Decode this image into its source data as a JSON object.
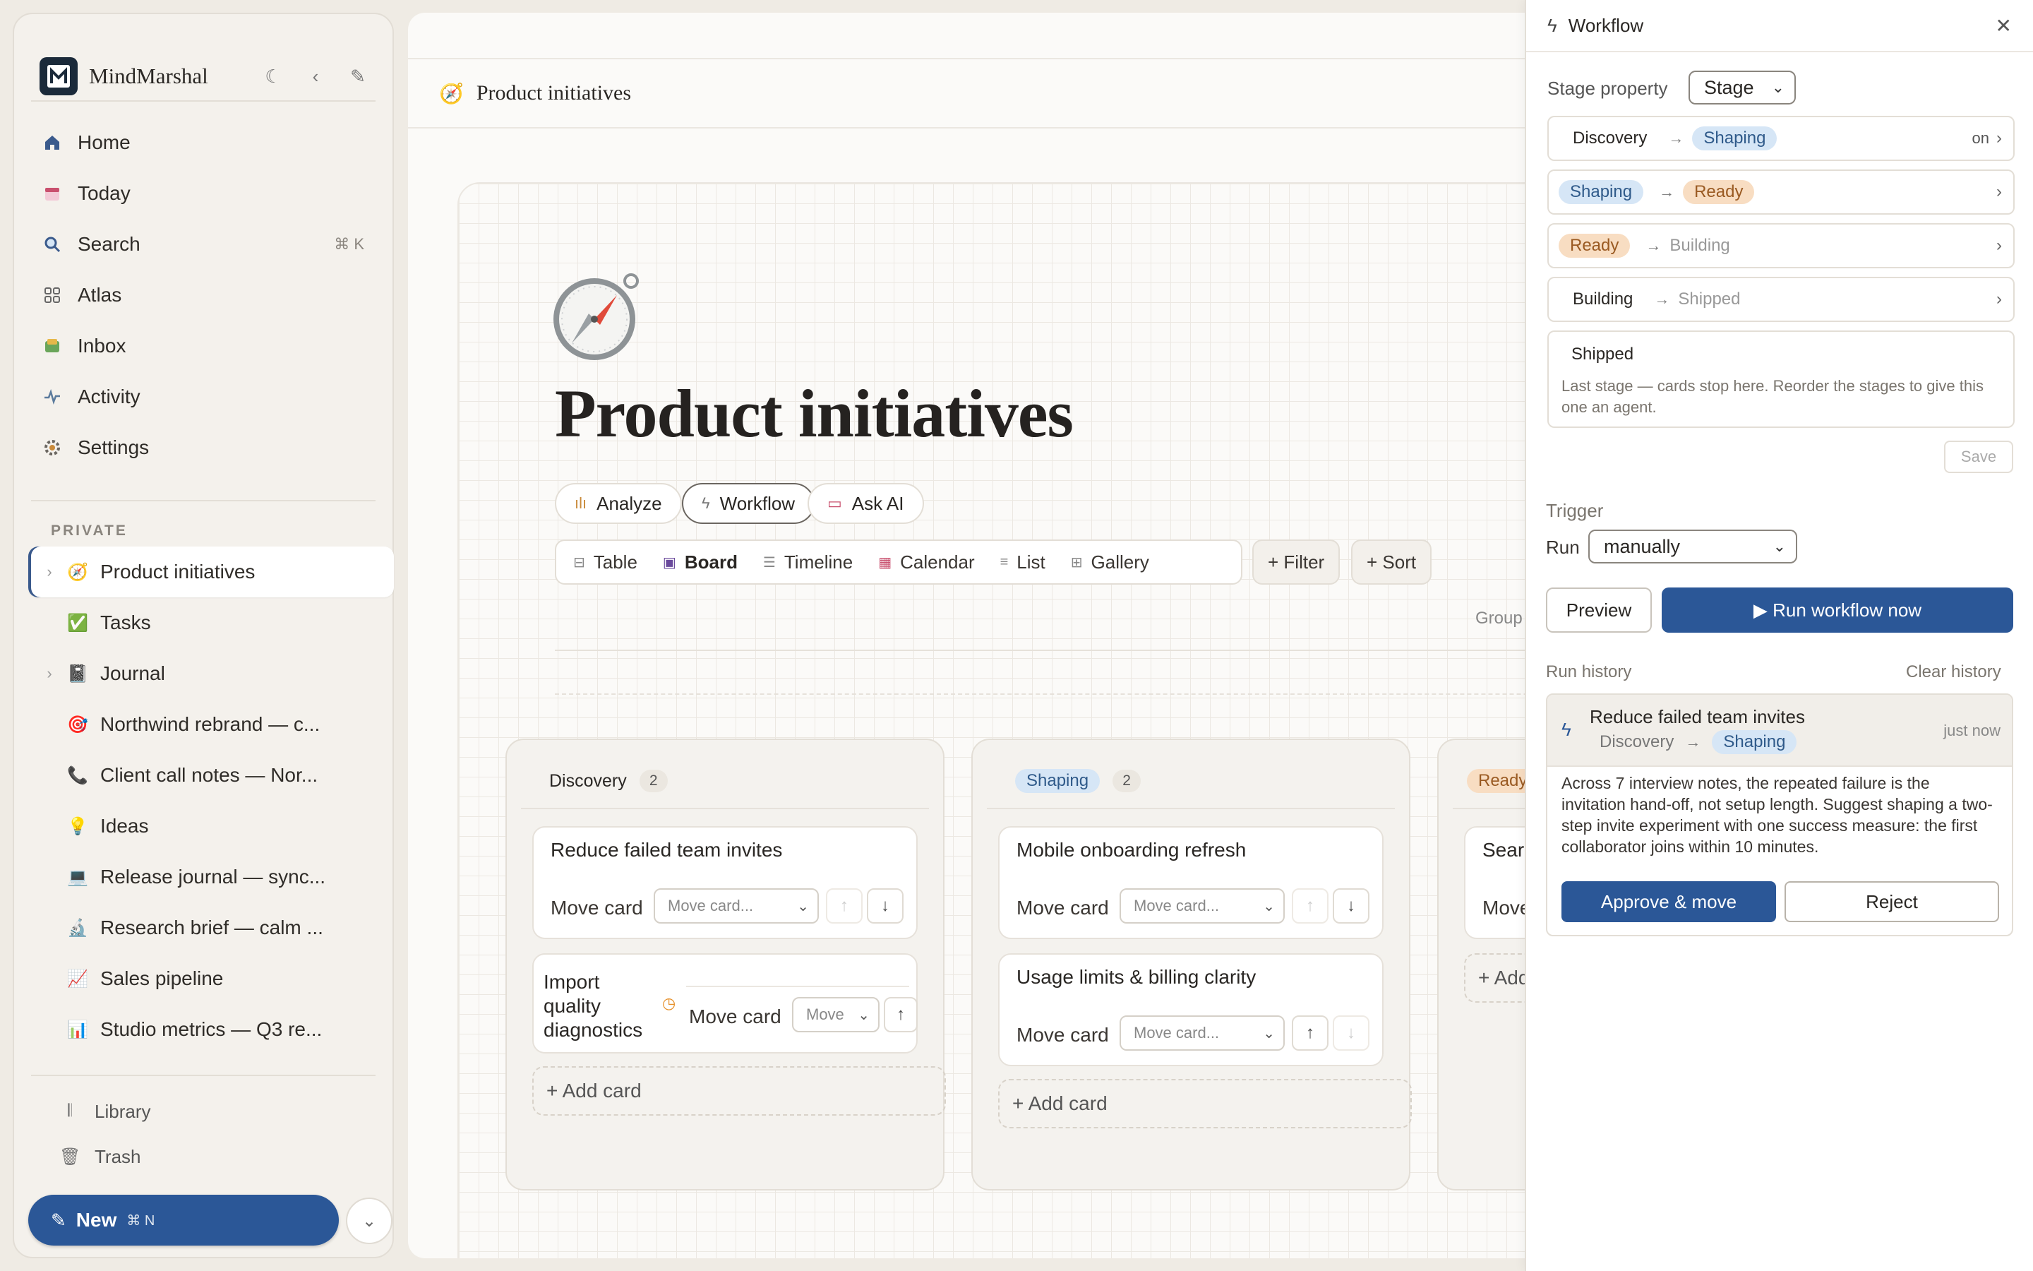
{
  "app": {
    "name": "MindMarshal"
  },
  "sidebar": {
    "nav": [
      {
        "label": "Home",
        "icon": "home-icon"
      },
      {
        "label": "Today",
        "icon": "calendar-icon"
      },
      {
        "label": "Search",
        "icon": "search-icon",
        "shortcut": "⌘ K"
      },
      {
        "label": "Atlas",
        "icon": "grid-icon"
      },
      {
        "label": "Inbox",
        "icon": "inbox-icon"
      },
      {
        "label": "Activity",
        "icon": "activity-icon"
      },
      {
        "label": "Settings",
        "icon": "gear-icon"
      }
    ],
    "section_label": "PRIVATE",
    "pages": [
      {
        "label": "Product initiatives",
        "emoji": "🧭",
        "active": true,
        "expandable": true
      },
      {
        "label": "Tasks",
        "emoji": "✅"
      },
      {
        "label": "Journal",
        "emoji": "📓",
        "expandable": true
      },
      {
        "label": "Northwind rebrand — c...",
        "emoji": "🎯"
      },
      {
        "label": "Client call notes — Nor...",
        "emoji": "📞"
      },
      {
        "label": "Ideas",
        "emoji": "💡"
      },
      {
        "label": "Release journal — sync...",
        "emoji": "💻"
      },
      {
        "label": "Research brief — calm ...",
        "emoji": "🔬"
      },
      {
        "label": "Sales pipeline",
        "emoji": "📈"
      },
      {
        "label": "Studio metrics — Q3 re...",
        "emoji": "📊"
      }
    ],
    "bottom": [
      {
        "label": "Library",
        "icon": "library-icon"
      },
      {
        "label": "Trash",
        "icon": "trash-icon"
      }
    ],
    "new_button": {
      "label": "New",
      "shortcut": "⌘ N"
    }
  },
  "main": {
    "breadcrumb": "Product initiatives",
    "title": "Product initiatives",
    "actions": [
      "Analyze",
      "Workflow",
      "Ask AI"
    ],
    "views": [
      "Table",
      "Board",
      "Timeline",
      "Calendar",
      "List",
      "Gallery"
    ],
    "filter_label": "+ Filter",
    "sort_label": "+ Sort",
    "group_label": "Group",
    "columns": [
      {
        "name": "Discovery",
        "count": "2",
        "cards": [
          {
            "title": "Reduce failed team invites",
            "move_label": "Move card",
            "select": "Move card..."
          },
          {
            "title_lines": [
              "Import",
              "quality",
              "diagnostics"
            ],
            "move_label": "Move card",
            "select": "Move"
          }
        ],
        "add_label": "+ Add card"
      },
      {
        "name": "Shaping",
        "count": "2",
        "cards": [
          {
            "title": "Mobile onboarding refresh",
            "move_label": "Move card",
            "select": "Move card..."
          },
          {
            "title": "Usage limits & billing clarity",
            "move_label": "Move card",
            "select": "Move card..."
          }
        ],
        "add_label": "+ Add card"
      },
      {
        "name": "Ready",
        "cards": [
          {
            "title": "Sear",
            "move_label": "Move"
          }
        ],
        "add_label": "+ Add"
      }
    ]
  },
  "workflow": {
    "title": "Workflow",
    "stage_property_label": "Stage property",
    "stage_property_value": "Stage",
    "transitions": [
      {
        "from": "Discovery",
        "to": "Shaping",
        "status": "on"
      },
      {
        "from": "Shaping",
        "to": "Ready"
      },
      {
        "from": "Ready",
        "to": "Building"
      },
      {
        "from": "Building",
        "to": "Shipped"
      }
    ],
    "last_stage": {
      "name": "Shipped",
      "note": "Last stage — cards stop here. Reorder the stages to give this one an agent."
    },
    "save_label": "Save",
    "trigger_label": "Trigger",
    "run_label": "Run",
    "run_value": "manually",
    "preview_label": "Preview",
    "run_now_label": "▶ Run workflow now",
    "history_label": "Run history",
    "clear_label": "Clear history",
    "history": [
      {
        "title": "Reduce failed team invites",
        "from": "Discovery",
        "to": "Shaping",
        "time": "just now",
        "body": "Across 7 interview notes, the repeated failure is the invitation hand-off, not setup length. Suggest shaping a two-step invite experiment with one success measure: the first collaborator joins within 10 minutes.",
        "approve_label": "Approve & move",
        "reject_label": "Reject"
      }
    ]
  }
}
